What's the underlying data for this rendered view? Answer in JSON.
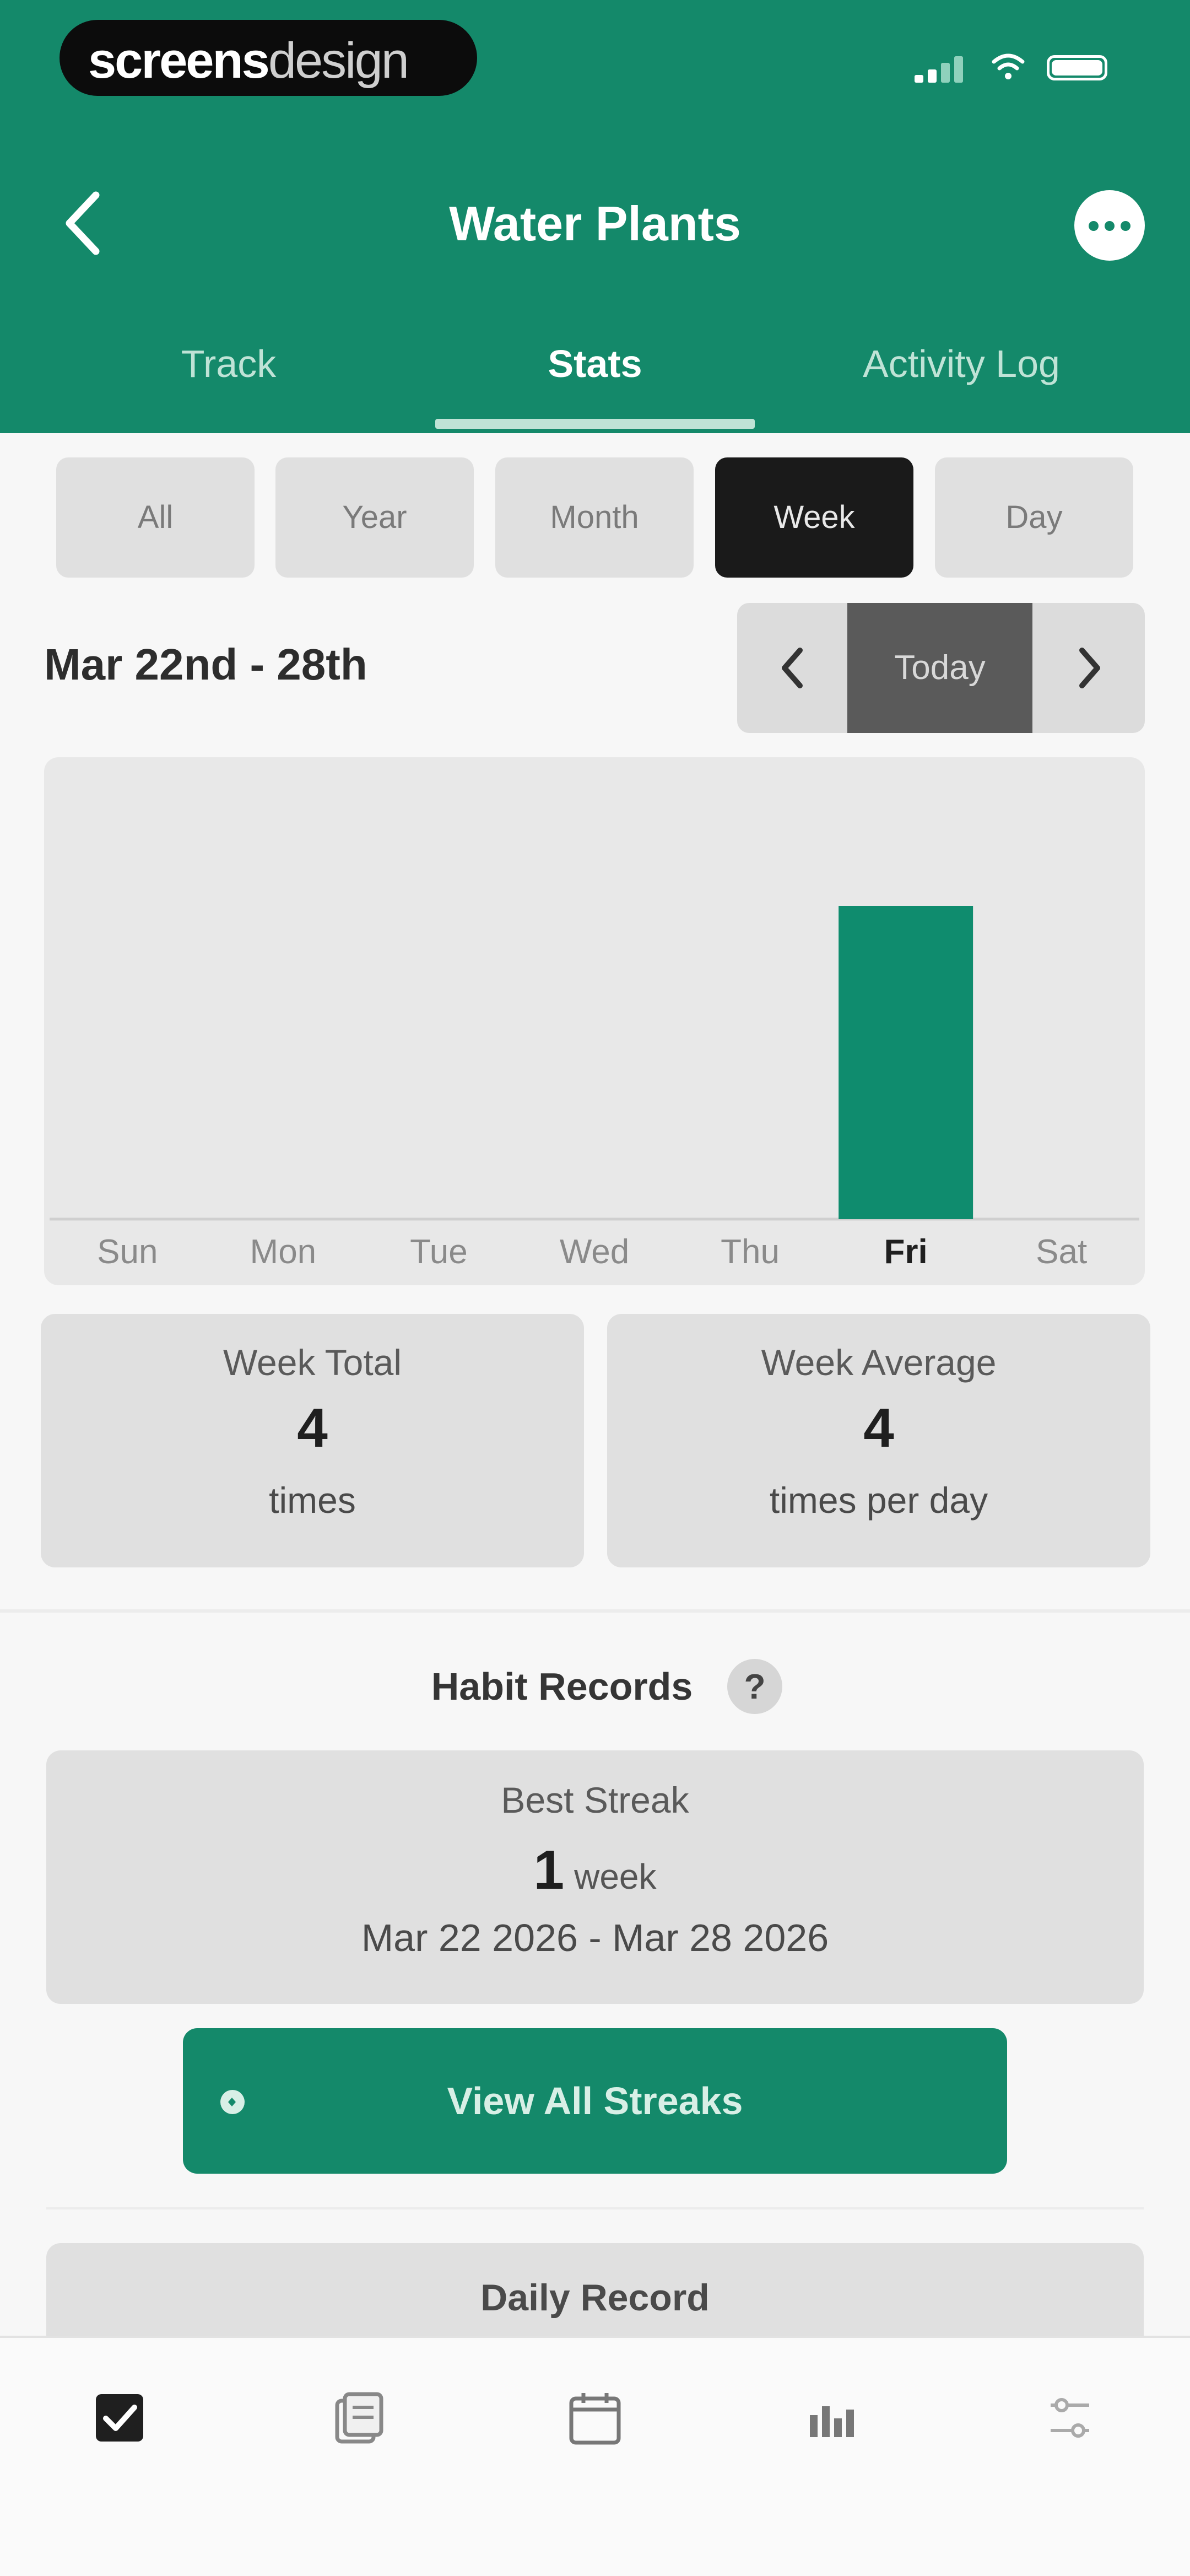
{
  "status_bar": {
    "brand_bold": "screens",
    "brand_light": "design"
  },
  "header": {
    "title": "Water Plants"
  },
  "tabs": [
    {
      "label": "Track"
    },
    {
      "label": "Stats",
      "active": true
    },
    {
      "label": "Activity Log"
    }
  ],
  "range_filters": {
    "options": [
      "All",
      "Year",
      "Month",
      "Week",
      "Day"
    ],
    "selected": "Week"
  },
  "date_nav": {
    "range": "Mar 22nd - 28th",
    "today_label": "Today"
  },
  "chart_data": {
    "type": "bar",
    "categories": [
      "Sun",
      "Mon",
      "Tue",
      "Wed",
      "Thu",
      "Fri",
      "Sat"
    ],
    "values": [
      0,
      0,
      0,
      0,
      0,
      4,
      0
    ],
    "highlighted": "Fri",
    "bar_color": "#0f8c6e"
  },
  "week_total": {
    "label": "Week Total",
    "value": "4",
    "unit": "times"
  },
  "week_average": {
    "label": "Week Average",
    "value": "4",
    "unit": "times per day"
  },
  "habit_records": {
    "title": "Habit Records",
    "help": "?",
    "best_streak_label": "Best Streak",
    "best_streak_value": "1",
    "best_streak_unit": "week",
    "best_streak_dates": "Mar 22 2026 - Mar 28 2026",
    "view_all_label": "View All Streaks",
    "daily_record_label": "Daily Record"
  },
  "bottom_nav": {
    "items": [
      {
        "icon": "checkbox-icon"
      },
      {
        "icon": "journal-icon"
      },
      {
        "icon": "calendar-icon"
      },
      {
        "icon": "stats-icon"
      },
      {
        "icon": "settings-icon"
      }
    ]
  },
  "colors": {
    "accent": "#14896a",
    "bar": "#0f8c6e",
    "selected_chip": "#1a1a1a"
  }
}
